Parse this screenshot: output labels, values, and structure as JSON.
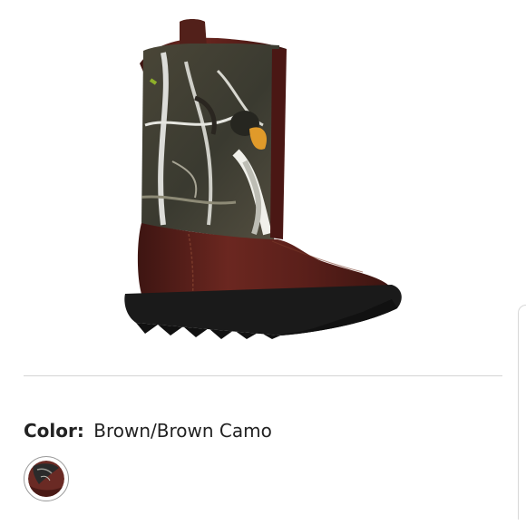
{
  "product": {
    "image_icon": "boot-product-image",
    "color_label": "Color:",
    "color_value": "Brown/Brown Camo",
    "swatches": [
      {
        "name": "brown-camo-swatch",
        "selected": true
      }
    ]
  },
  "colors": {
    "leather": "#5a1f1a",
    "sole": "#1a1a1a",
    "divider": "#d4d4d4"
  }
}
